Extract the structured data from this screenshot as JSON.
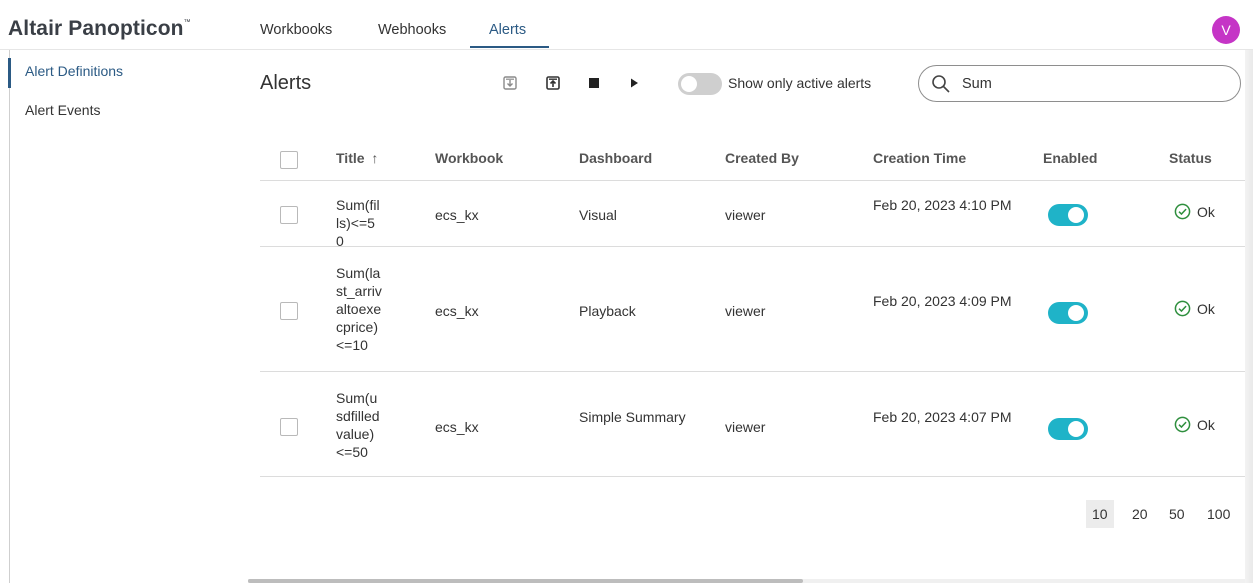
{
  "app": {
    "brand": "Altair Panopticon",
    "brand_mark": "™",
    "avatar_initial": "V",
    "avatar_color": "#c535c6",
    "accent_color": "#2b5a84",
    "toggle_on_color": "#1fb3c8"
  },
  "nav": {
    "tabs": [
      {
        "label": "Workbooks"
      },
      {
        "label": "Webhooks"
      },
      {
        "label": "Alerts",
        "active": true
      }
    ]
  },
  "sidebar": {
    "items": [
      {
        "label": "Alert Definitions",
        "active": true
      },
      {
        "label": "Alert Events"
      }
    ]
  },
  "toolbar": {
    "title": "Alerts",
    "buttons": [
      "import-icon",
      "export-icon",
      "stop-icon",
      "play-icon"
    ],
    "active_toggle_label": "Show only active alerts",
    "active_toggle_on": false,
    "search_value": "Sum",
    "search_icon": "search-icon"
  },
  "table": {
    "columns": {
      "title": "Title",
      "workbook": "Workbook",
      "dashboard": "Dashboard",
      "created_by": "Created By",
      "creation_time": "Creation Time",
      "enabled": "Enabled",
      "status": "Status"
    },
    "sort_indicator": "↑",
    "rows": [
      {
        "title": "Sum(fills)<=50",
        "workbook": "ecs_kx",
        "dashboard": "Visual",
        "created_by": "viewer",
        "creation_time": "Feb 20, 2023 4:10 PM",
        "enabled": true,
        "status": "Ok"
      },
      {
        "title": "Sum(last_arrivaltoexecprice)<=10",
        "workbook": "ecs_kx",
        "dashboard": "Playback",
        "created_by": "viewer",
        "creation_time": "Feb 20, 2023 4:09 PM",
        "enabled": true,
        "status": "Ok"
      },
      {
        "title": "Sum(usdfilledvalue)<=50",
        "workbook": "ecs_kx",
        "dashboard": "Simple Summary",
        "created_by": "viewer",
        "creation_time": "Feb 20, 2023 4:07 PM",
        "enabled": true,
        "status": "Ok"
      }
    ]
  },
  "pagination": {
    "page_sizes": [
      "10",
      "20",
      "50",
      "100"
    ],
    "selected": "10"
  }
}
